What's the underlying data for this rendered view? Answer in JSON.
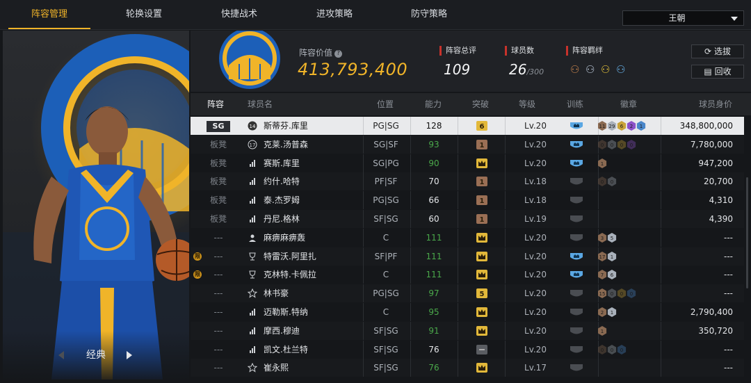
{
  "tabs": [
    "阵容管理",
    "轮换设置",
    "快捷战术",
    "进攻策略",
    "防守策略"
  ],
  "active_tab": 0,
  "team_select": {
    "value": "王朝"
  },
  "hero": {
    "edition": "经典"
  },
  "summary": {
    "value_label": "阵容价值",
    "value": "413,793,400",
    "overall_label": "阵容总评",
    "overall": "109",
    "players_label": "球员数",
    "players": "26",
    "players_max": "/300",
    "bonds_label": "阵容羁绊",
    "select_button": "选拔",
    "recycle_button": "回收"
  },
  "headers": {
    "slot": "阵容",
    "name": "球员名",
    "pos": "位置",
    "ability": "能力",
    "breakthrough": "突破",
    "level": "等级",
    "training": "训练",
    "badges": "徽章",
    "value": "球员身价"
  },
  "rows": [
    {
      "slot": "SG",
      "icon": "jersey",
      "name": "斯蒂芬.库里",
      "pos": "PG|SG",
      "ability": "128",
      "green": false,
      "brk": "6",
      "brk_type": "num",
      "lv": "Lv.20",
      "train": "blue",
      "badges": [
        [
          "11",
          "br"
        ],
        [
          "29",
          "sv"
        ],
        [
          "6",
          "gd"
        ],
        [
          "2",
          "pu"
        ],
        [
          "1",
          "bl"
        ]
      ],
      "value": "348,800,000",
      "selected": true,
      "limited": false
    },
    {
      "slot": "板凳",
      "icon": "num17",
      "name": "克莱.汤普森",
      "pos": "SG|SF",
      "ability": "93",
      "green": true,
      "brk": "1",
      "brk_type": "num",
      "lv": "Lv.20",
      "train": "blue",
      "badges": [
        [
          "0",
          "br"
        ],
        [
          "0",
          "sv"
        ],
        [
          "0",
          "gd"
        ],
        [
          "0",
          "pu"
        ]
      ],
      "value": "7,780,000",
      "selected": false,
      "limited": false
    },
    {
      "slot": "板凳",
      "icon": "bars",
      "name": "赛斯.库里",
      "pos": "SG|PG",
      "ability": "90",
      "green": true,
      "brk": "crown",
      "brk_type": "crown",
      "lv": "Lv.20",
      "train": "blue",
      "badges": [
        [
          "1",
          "br"
        ]
      ],
      "value": "947,200",
      "selected": false,
      "limited": false
    },
    {
      "slot": "板凳",
      "icon": "bars",
      "name": "约什.哈特",
      "pos": "PF|SF",
      "ability": "70",
      "green": false,
      "brk": "1",
      "brk_type": "num",
      "lv": "Lv.18",
      "train": "grey",
      "badges": [
        [
          "0",
          "br"
        ],
        [
          "0",
          "sv"
        ]
      ],
      "value": "20,700",
      "selected": false,
      "limited": false
    },
    {
      "slot": "板凳",
      "icon": "bars",
      "name": "泰.杰罗姆",
      "pos": "PG|SG",
      "ability": "66",
      "green": false,
      "brk": "1",
      "brk_type": "num",
      "lv": "Lv.18",
      "train": "grey",
      "badges": [],
      "value": "4,310",
      "selected": false,
      "limited": false
    },
    {
      "slot": "板凳",
      "icon": "bars",
      "name": "丹尼.格林",
      "pos": "SF|SG",
      "ability": "60",
      "green": false,
      "brk": "1",
      "brk_type": "num",
      "lv": "Lv.19",
      "train": "grey",
      "badges": [],
      "value": "4,390",
      "selected": false,
      "limited": false
    },
    {
      "slot": "---",
      "icon": "person",
      "name": "麻痹麻痹轰",
      "pos": "C",
      "ability": "111",
      "green": true,
      "brk": "crown",
      "brk_type": "crown",
      "lv": "Lv.20",
      "train": "grey",
      "badges": [
        [
          "3",
          "br"
        ],
        [
          "5",
          "sv"
        ]
      ],
      "value": "---",
      "selected": false,
      "limited": false
    },
    {
      "slot": "---",
      "icon": "trophy",
      "name": "特雷沃.阿里扎",
      "pos": "SF|PF",
      "ability": "111",
      "green": true,
      "brk": "crown",
      "brk_type": "crown",
      "lv": "Lv.20",
      "train": "blue",
      "badges": [
        [
          "17",
          "br"
        ],
        [
          "1",
          "sv"
        ]
      ],
      "value": "---",
      "selected": false,
      "limited": true
    },
    {
      "slot": "---",
      "icon": "trophy",
      "name": "克林特.卡佩拉",
      "pos": "C",
      "ability": "111",
      "green": true,
      "brk": "crown",
      "brk_type": "crown",
      "lv": "Lv.20",
      "train": "blue",
      "badges": [
        [
          "7",
          "br"
        ],
        [
          "6",
          "sv"
        ]
      ],
      "value": "---",
      "selected": false,
      "limited": true
    },
    {
      "slot": "---",
      "icon": "star",
      "name": "林书豪",
      "pos": "PG|SG",
      "ability": "97",
      "green": true,
      "brk": "5",
      "brk_type": "num",
      "lv": "Lv.20",
      "train": "grey",
      "badges": [
        [
          "15",
          "br"
        ],
        [
          "0",
          "sv"
        ],
        [
          "0",
          "gd"
        ],
        [
          "0",
          "bl"
        ]
      ],
      "value": "---",
      "selected": false,
      "limited": false
    },
    {
      "slot": "---",
      "icon": "bars",
      "name": "迈勒斯.特纳",
      "pos": "C",
      "ability": "95",
      "green": true,
      "brk": "crown",
      "brk_type": "crown",
      "lv": "Lv.20",
      "train": "grey",
      "badges": [
        [
          "2",
          "br"
        ],
        [
          "1",
          "sv"
        ]
      ],
      "value": "2,790,400",
      "selected": false,
      "limited": false
    },
    {
      "slot": "---",
      "icon": "bars",
      "name": "摩西.穆迪",
      "pos": "SF|SG",
      "ability": "91",
      "green": true,
      "brk": "crown",
      "brk_type": "crown",
      "lv": "Lv.20",
      "train": "grey",
      "badges": [
        [
          "1",
          "br"
        ]
      ],
      "value": "350,720",
      "selected": false,
      "limited": false
    },
    {
      "slot": "---",
      "icon": "bars",
      "name": "凯文.杜兰特",
      "pos": "SF|SG",
      "ability": "76",
      "green": false,
      "brk": "-",
      "brk_type": "dash",
      "lv": "Lv.20",
      "train": "grey",
      "badges": [
        [
          "0",
          "br"
        ],
        [
          "0",
          "sv"
        ],
        [
          "0",
          "bl"
        ]
      ],
      "value": "---",
      "selected": false,
      "limited": false
    },
    {
      "slot": "---",
      "icon": "star",
      "name": "崔永熙",
      "pos": "SF|SG",
      "ability": "76",
      "green": true,
      "brk": "crown",
      "brk_type": "crown",
      "lv": "Lv.17",
      "train": "grey",
      "badges": [],
      "value": "---",
      "selected": false,
      "limited": false
    }
  ],
  "limited_label": "限"
}
